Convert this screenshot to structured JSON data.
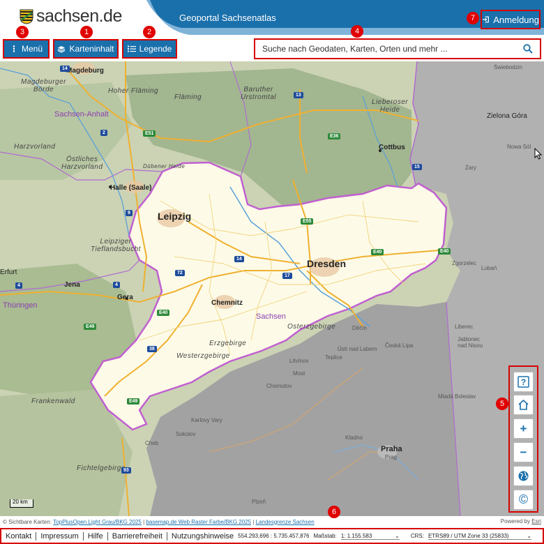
{
  "header": {
    "logo_text": "sachsen.de",
    "app_title": "Geoportal Sachsenatlas",
    "login_label": "Anmeldung"
  },
  "toolbar": {
    "menu_label": "Menü",
    "content_label": "Karteninhalt",
    "legend_label": "Legende"
  },
  "search": {
    "placeholder": "Suche nach Geodaten, Karten, Orten und mehr ..."
  },
  "markers": [
    "1",
    "2",
    "3",
    "4",
    "5",
    "6",
    "7"
  ],
  "map": {
    "cities": {
      "magdeburg": "Magdeburg",
      "halle": "Halle (Saale)",
      "leipzig": "Leipzig",
      "dresden": "Dresden",
      "chemnitz": "Chemnitz",
      "cottbus": "Cottbus",
      "jena": "Jena",
      "gera": "Gera",
      "erfurt": "Erfurt",
      "zielona_gora": "Zielona Góra",
      "praha": "Praha",
      "praha_sub": "Prag"
    },
    "regions": {
      "sachsen_anhalt": "Sachsen-Anhalt",
      "thueringen": "Thüringen",
      "sachsen": "Sachsen",
      "hoher_flaeming": "Hoher Fläming",
      "flaeming": "Fläming",
      "baruther": "Baruther\nUrstromtal",
      "lieberoser": "Lieberoser\nHeide",
      "magdeburger_boerde": "Magdeburger\nBörde",
      "harzvorland": "Harzvorland",
      "oestliches_harzvorland": "Östliches\nHarzvorland",
      "leipziger_tieflandsbucht": "Leipziger\nTieflandsbucht",
      "erzgebirge": "Erzgebirge",
      "westerzgebirge": "Westerzgebirge",
      "osterzgebirge": "Osterzgebirge",
      "frankenwald": "Frankenwald",
      "fichtelgebirge": "Fichtelgebirge",
      "duebener_heide": "Dübener Heide"
    },
    "small_places": {
      "swiebodzin": "Świebodzin",
      "nowa_sol": "Nowa Sól",
      "zary": "Żary",
      "zgorzelec": "Zgorzelec",
      "luban": "Lubań",
      "liberec": "Liberec",
      "jablonec": "Jablonec\nnad Nisou",
      "decin": "Děčín",
      "usti": "Ústí nad Labem",
      "ceska_lipa": "Česká Lípa",
      "teplice": "Teplice",
      "litvinov": "Litvínov",
      "most": "Most",
      "chomutov": "Chomutov",
      "karlovy_vary": "Karlovy Vary",
      "sokolov": "Sokolov",
      "cheb": "Cheb",
      "kladno": "Kladno",
      "mlada_boleslav": "Mladá Boleslav",
      "plzen": "Plzeň"
    },
    "roads": {
      "a14_top": "14",
      "a2": "2",
      "a13": "13",
      "a15": "15",
      "a9": "9",
      "a14": "14",
      "a38": "38",
      "a72": "72",
      "a17": "17",
      "a4_left": "4",
      "a4_mid": "4",
      "a93": "93",
      "e51": "E51",
      "e36": "E36",
      "e55": "E55",
      "e40_left": "E40",
      "e40_mid": "E40",
      "e40_right": "E40",
      "e49": "E49",
      "e49_b": "E49"
    },
    "scale_label": "20 km"
  },
  "controls": {
    "help_icon": "help-icon",
    "home_icon": "home-icon",
    "zoom_in": "+",
    "zoom_out": "−",
    "globe_icon": "globe-icon",
    "copyright": "©"
  },
  "attribution": {
    "prefix": "© Sichtbare Karten:",
    "link1": "TopPlusOpen Light Grau/BKG 2025",
    "link2": "basemap.de Web Raster Farbe/BKG 2025",
    "link3": "Landesgrenze Sachsen",
    "powered": "Powered by",
    "powered_link": "Esri"
  },
  "footer": {
    "links": [
      "Kontakt",
      "Impressum",
      "Hilfe",
      "Barrierefreiheit",
      "Nutzungshinweise"
    ],
    "coords": "554.293,696 : 5.735.457,876",
    "scale_label": "Maßstab:",
    "scale_value": "1: 1.155.583",
    "crs_label": "CRS:",
    "crs_value": "ETRS89 / UTM Zone 33 (25833)"
  },
  "colors": {
    "primary": "#1a70ab",
    "highlight": "#d60000",
    "marker": "#e00000",
    "saxony_fill": "#fdfbe8",
    "border_purple": "#c060d0"
  }
}
